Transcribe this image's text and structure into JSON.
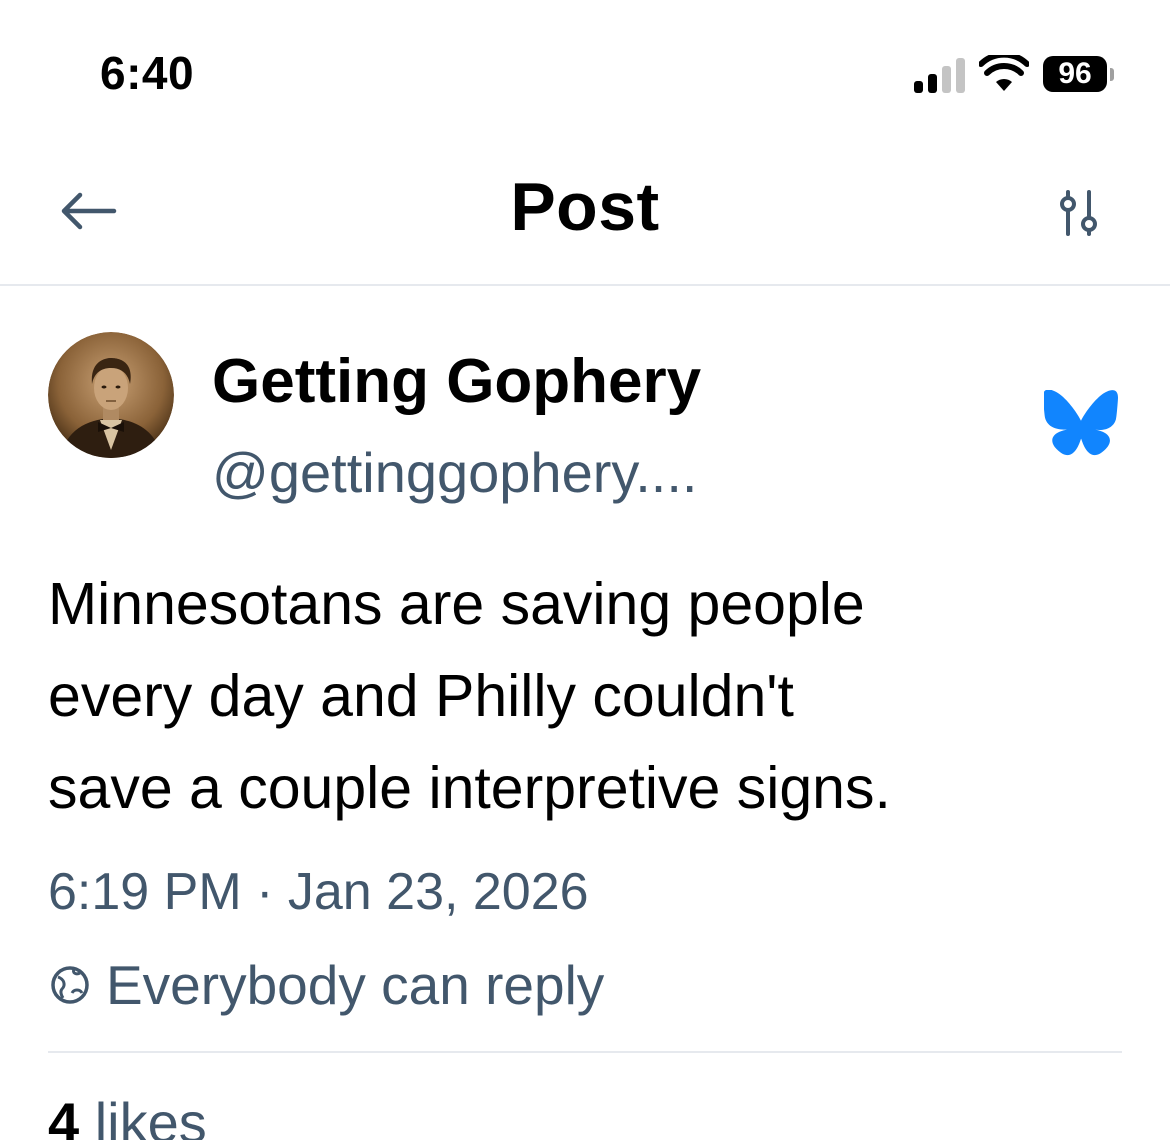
{
  "status_bar": {
    "time": "6:40",
    "battery_level": "96",
    "signal_bars_active": 2,
    "signal_bars_total": 4
  },
  "header": {
    "title": "Post",
    "back_icon": "arrow-left-icon",
    "settings_icon": "sliders-icon"
  },
  "post": {
    "author_name": "Getting Gophery",
    "author_handle": "@gettinggophery....",
    "text": "Minnesotans are saving people\nevery day and Philly couldn't\nsave a couple interpretive signs.",
    "timestamp": "6:19 PM · Jan 23, 2026",
    "reply_setting": "Everybody can reply",
    "reply_setting_icon": "globe-icon",
    "likes_count": "4",
    "likes_label": "likes",
    "app_logo_icon": "bluesky-butterfly-icon"
  },
  "colors": {
    "secondary_text": "#42576c",
    "divider": "#e6e9ee",
    "brand_blue": "#1185fe"
  }
}
